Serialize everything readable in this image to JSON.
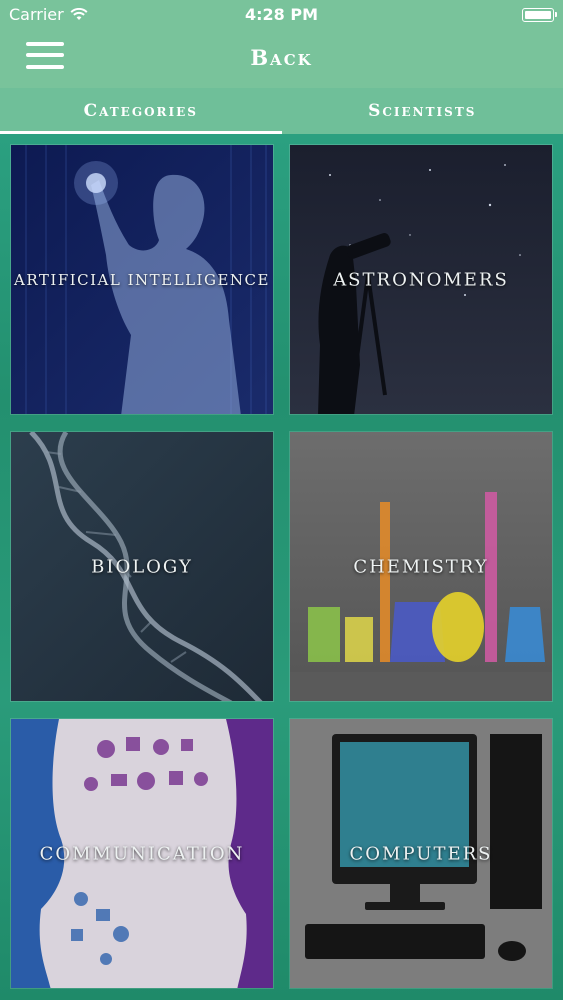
{
  "status_bar": {
    "carrier": "Carrier",
    "time": "4:28 PM"
  },
  "nav": {
    "title": "Back"
  },
  "tabs": [
    {
      "label": "Categories",
      "active": true
    },
    {
      "label": "Scientists",
      "active": false
    }
  ],
  "categories": [
    {
      "label": "ARTIFICIAL INTELLIGENCE",
      "image": "robot-human"
    },
    {
      "label": "ASTRONOMERS",
      "image": "telescope-night-sky"
    },
    {
      "label": "BIOLOGY",
      "image": "dna-helix"
    },
    {
      "label": "CHEMISTRY",
      "image": "lab-glassware"
    },
    {
      "label": "COMMUNICATION",
      "image": "faces-speech-icons"
    },
    {
      "label": "COMPUTERS",
      "image": "desktop-computer"
    }
  ],
  "colors": {
    "header": "#79c39b",
    "tabs": "#6fbf99",
    "background": "#2a9b7a"
  }
}
